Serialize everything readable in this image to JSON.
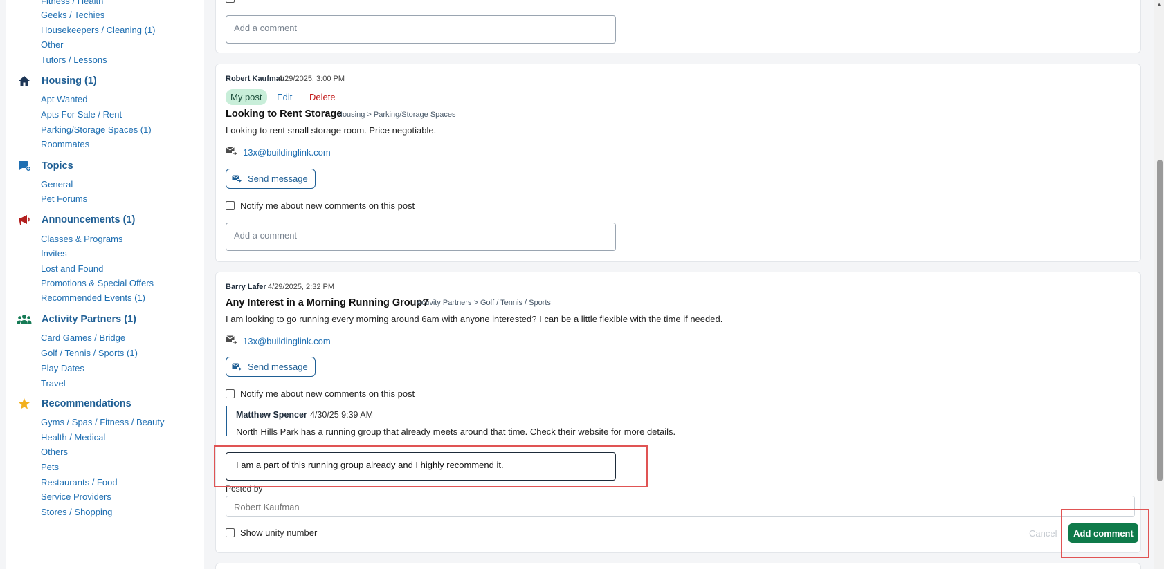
{
  "sidebar": {
    "top_partial": "Fitness / Health",
    "tutor_items": [
      "Geeks / Techies",
      "Housekeepers / Cleaning (1)",
      "Other",
      "Tutors / Lessons"
    ],
    "housing": {
      "label": "Housing (1)",
      "items": [
        "Apt Wanted",
        "Apts For Sale / Rent",
        "Parking/Storage Spaces (1)",
        "Roommates"
      ]
    },
    "topics": {
      "label": "Topics",
      "items": [
        "General",
        "Pet Forums"
      ]
    },
    "announcements": {
      "label": "Announcements (1)",
      "items": [
        "Classes & Programs",
        "Invites",
        "Lost and Found",
        "Promotions & Special Offers",
        "Recommended Events (1)"
      ]
    },
    "activity": {
      "label": "Activity Partners (1)",
      "items": [
        "Card Games / Bridge",
        "Golf / Tennis / Sports (1)",
        "Play Dates",
        "Travel"
      ]
    },
    "recommendations": {
      "label": "Recommendations",
      "items": [
        "Gyms / Spas / Fitness / Beauty",
        "Health / Medical",
        "Others",
        "Pets",
        "Restaurants / Food",
        "Service Providers",
        "Stores / Shopping"
      ]
    }
  },
  "post0": {
    "comment_placeholder": "Add a comment"
  },
  "post1": {
    "author": "Robert Kaufman",
    "time": "4/29/2025, 3:00 PM",
    "my_post": "My post",
    "edit": "Edit",
    "delete": "Delete",
    "title": "Looking to Rent Storage",
    "path": "Housing > Parking/Storage Spaces",
    "body": "Looking to rent small storage room. Price negotiable.",
    "email": "13x@buildinglink.com",
    "send": "Send message",
    "notify": "Notify me about new comments on this post",
    "comment_placeholder": "Add a comment"
  },
  "post2": {
    "author": "Barry Lafer",
    "time": "4/29/2025, 2:32 PM",
    "title": "Any Interest in a Morning Running Group?",
    "path": "Activity Partners > Golf / Tennis / Sports",
    "body": "I am looking to go running every morning around 6am with anyone interested? I can be a little flexible with the time if needed.",
    "email": "13x@buildinglink.com",
    "send": "Send message",
    "notify": "Notify me about new comments on this post",
    "reply": {
      "author": "Matthew Spencer",
      "time": "4/30/25 9:39 AM",
      "text": "North Hills Park has a running group that already meets around that time. Check their website for more details."
    },
    "new_comment": "I am a part of this running group already and I highly recommend it.",
    "posted_by_label": "Posted by",
    "posted_by_value": "Robert Kaufman",
    "show_unity": "Show unity number",
    "cancel": "Cancel",
    "add_comment": "Add comment"
  },
  "colors": {
    "link": "#1f6fb2",
    "category": "#1f5f95",
    "primary_button": "#0f7a4a",
    "my_post_badge": "#c8eed9",
    "delete": "#c21818",
    "highlight": "#e05454"
  }
}
